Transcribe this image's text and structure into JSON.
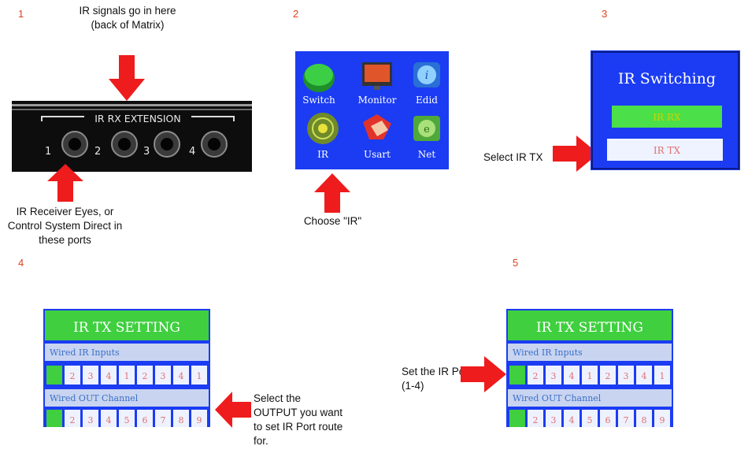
{
  "steps": {
    "s1": "1",
    "s2": "2",
    "s3": "3",
    "s4": "4",
    "s5": "5"
  },
  "captions": {
    "ir_in_top": "IR signals go in here (back of Matrix)",
    "receiver_eyes": "IR Receiver Eyes, or Control System Direct in these ports",
    "choose_ir": "Choose \"IR\"",
    "select_irtx": "Select IR TX",
    "select_output": "Select the OUTPUT you want to set IR Port route for.",
    "set_port": "Set the IR Port (1-4)"
  },
  "panel": {
    "label": "IR RX EXTENSION",
    "ports": [
      "1",
      "2",
      "3",
      "4"
    ]
  },
  "menu": {
    "items": [
      {
        "label": "Switch",
        "icon": "green-button-icon"
      },
      {
        "label": "Monitor",
        "icon": "monitor-icon"
      },
      {
        "label": "Edid",
        "icon": "info-icon"
      },
      {
        "label": "IR",
        "icon": "ir-signal-icon"
      },
      {
        "label": "Usart",
        "icon": "handshake-icon"
      },
      {
        "label": "Net",
        "icon": "network-icon"
      }
    ]
  },
  "ir_switching": {
    "title": "IR Switching",
    "rx": "IR RX",
    "tx": "IR TX"
  },
  "tx_setting": {
    "title": "IR TX SETTING",
    "inputs_label": "Wired IR Inputs",
    "inputs": [
      "",
      "2",
      "3",
      "4",
      "1",
      "2",
      "3",
      "4",
      "1"
    ],
    "inputs_set": [
      "",
      "2",
      "3",
      "4",
      "1",
      "2",
      "3",
      "4",
      "1"
    ],
    "out_label": "Wired OUT Channel",
    "outputs": [
      "",
      "2",
      "3",
      "4",
      "5",
      "6",
      "7",
      "8",
      "9"
    ]
  },
  "colors": {
    "arrow": "#ee1c1c",
    "step": "#e0401c",
    "screen_blue": "#1b3cf2",
    "lcd_green": "#3fcf3f"
  }
}
